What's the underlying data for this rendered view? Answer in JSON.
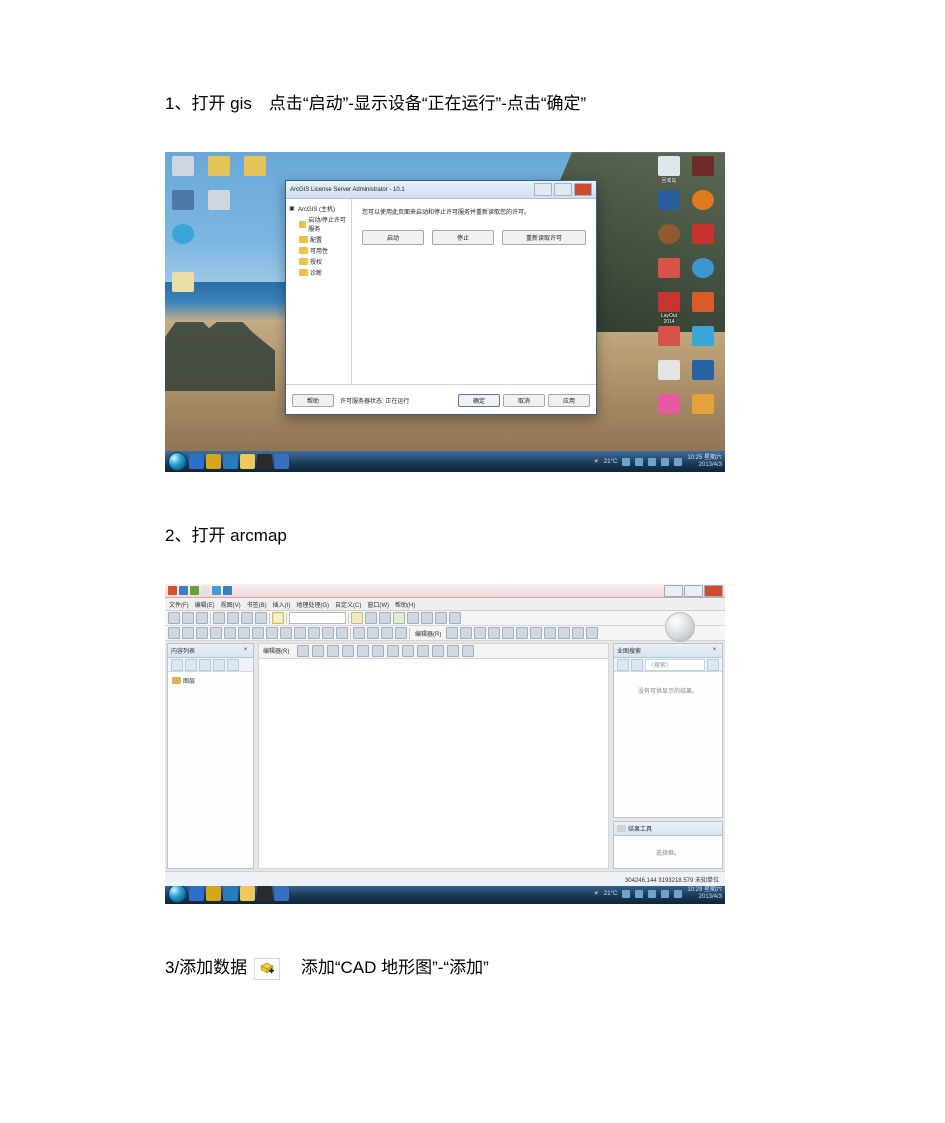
{
  "steps": {
    "s1": "1、打开 gis 点击“启动”-显示设备“正在运行”-点击“确定”",
    "s2": "2、打开 arcmap",
    "s3_prefix": "3/添加数据",
    "s3_suffix": "添加“CAD 地形图”-“添加”"
  },
  "shot1": {
    "dialog_title": "ArcGIS License Server Administrator - 10.1",
    "tree_root": "ArcGIS (主机)",
    "tree_items": [
      "启动/停止许可服务",
      "配置",
      "可用性",
      "授权",
      "诊断"
    ],
    "instruction": "您可以使用此页面来启动和停止许可服务并重新读取您的许可。",
    "btn_start": "启动",
    "btn_stop": "停止",
    "btn_reread": "重新读取许可",
    "btn_help": "帮助",
    "status_text": "许可服务器状态: 正在运行",
    "btn_ok": "确定",
    "btn_cancel": "取消",
    "btn_apply": "应用",
    "desk_labels": {
      "trash": "回收站",
      "layout": "LayOut\n2014"
    },
    "taskbar": {
      "weather": "21°C",
      "time": "10:25 星期六",
      "date": "2013/4/3"
    }
  },
  "shot2": {
    "menu": [
      "文件(F)",
      "编辑(E)",
      "视图(V)",
      "书签(B)",
      "插入(I)",
      "地理处理(G)",
      "自定义(C)",
      "窗口(W)",
      "帮助(H)"
    ],
    "toolbar_label": "编辑器(R)",
    "toc_title": "内容列表",
    "toc_root": "图层",
    "search_title": "业图搜索",
    "search_box": "〈搜索〉",
    "search_empty": "没有可供显示的结果。",
    "results_title": "结果工具",
    "results_empty": "选择框。",
    "status_coord": "304246.144  3193218.579 未知单位",
    "taskbar": {
      "weather": "21°C",
      "time": "10:29 星期六",
      "date": "2013/4/3"
    }
  }
}
